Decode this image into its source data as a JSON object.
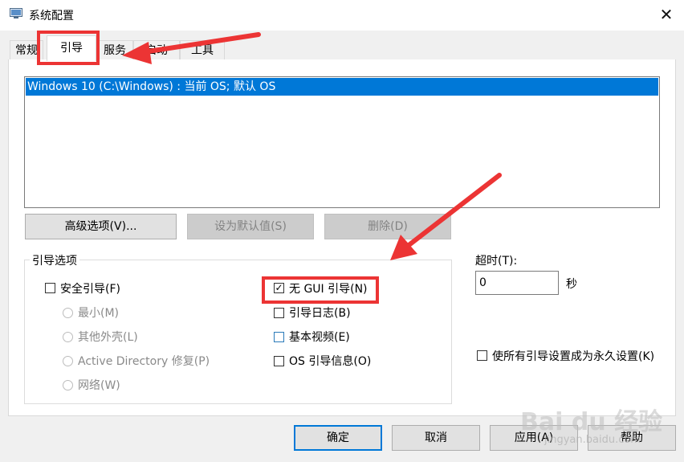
{
  "window": {
    "title": "系统配置",
    "close_glyph": "✕"
  },
  "tabs": [
    {
      "label": "常规"
    },
    {
      "label": "引导"
    },
    {
      "label": "服务"
    },
    {
      "label": "启动"
    },
    {
      "label": "工具"
    }
  ],
  "boot_list": {
    "items": [
      "Windows 10 (C:\\Windows) : 当前 OS; 默认 OS"
    ]
  },
  "list_buttons": {
    "advanced": "高级选项(V)...",
    "set_default": "设为默认值(S)",
    "delete": "删除(D)"
  },
  "boot_options": {
    "legend": "引导选项",
    "safe_boot": {
      "label": "安全引导(F)",
      "checked": false
    },
    "radios": [
      "最小(M)",
      "其他外壳(L)",
      "Active Directory 修复(P)",
      "网络(W)"
    ],
    "no_gui": {
      "label": "无 GUI 引导(N)",
      "checked": true,
      "check_glyph": "✓"
    },
    "boot_log": {
      "label": "引导日志(B)",
      "checked": false
    },
    "base_video": {
      "label": "基本视频(E)",
      "checked": false
    },
    "os_info": {
      "label": "OS 引导信息(O)",
      "checked": false
    }
  },
  "timeout": {
    "label": "超时(T):",
    "value": "0",
    "unit": "秒"
  },
  "permanent": {
    "label": "使所有引导设置成为永久设置(K)",
    "checked": false
  },
  "footer_buttons": {
    "ok": "确定",
    "cancel": "取消",
    "apply": "应用(A)",
    "help": "帮助"
  },
  "watermark": {
    "text": "Bai du 经验",
    "sub": "jingyan.baidu.com"
  },
  "colors": {
    "annotation": "#ec3434",
    "selection": "#0078d7"
  }
}
